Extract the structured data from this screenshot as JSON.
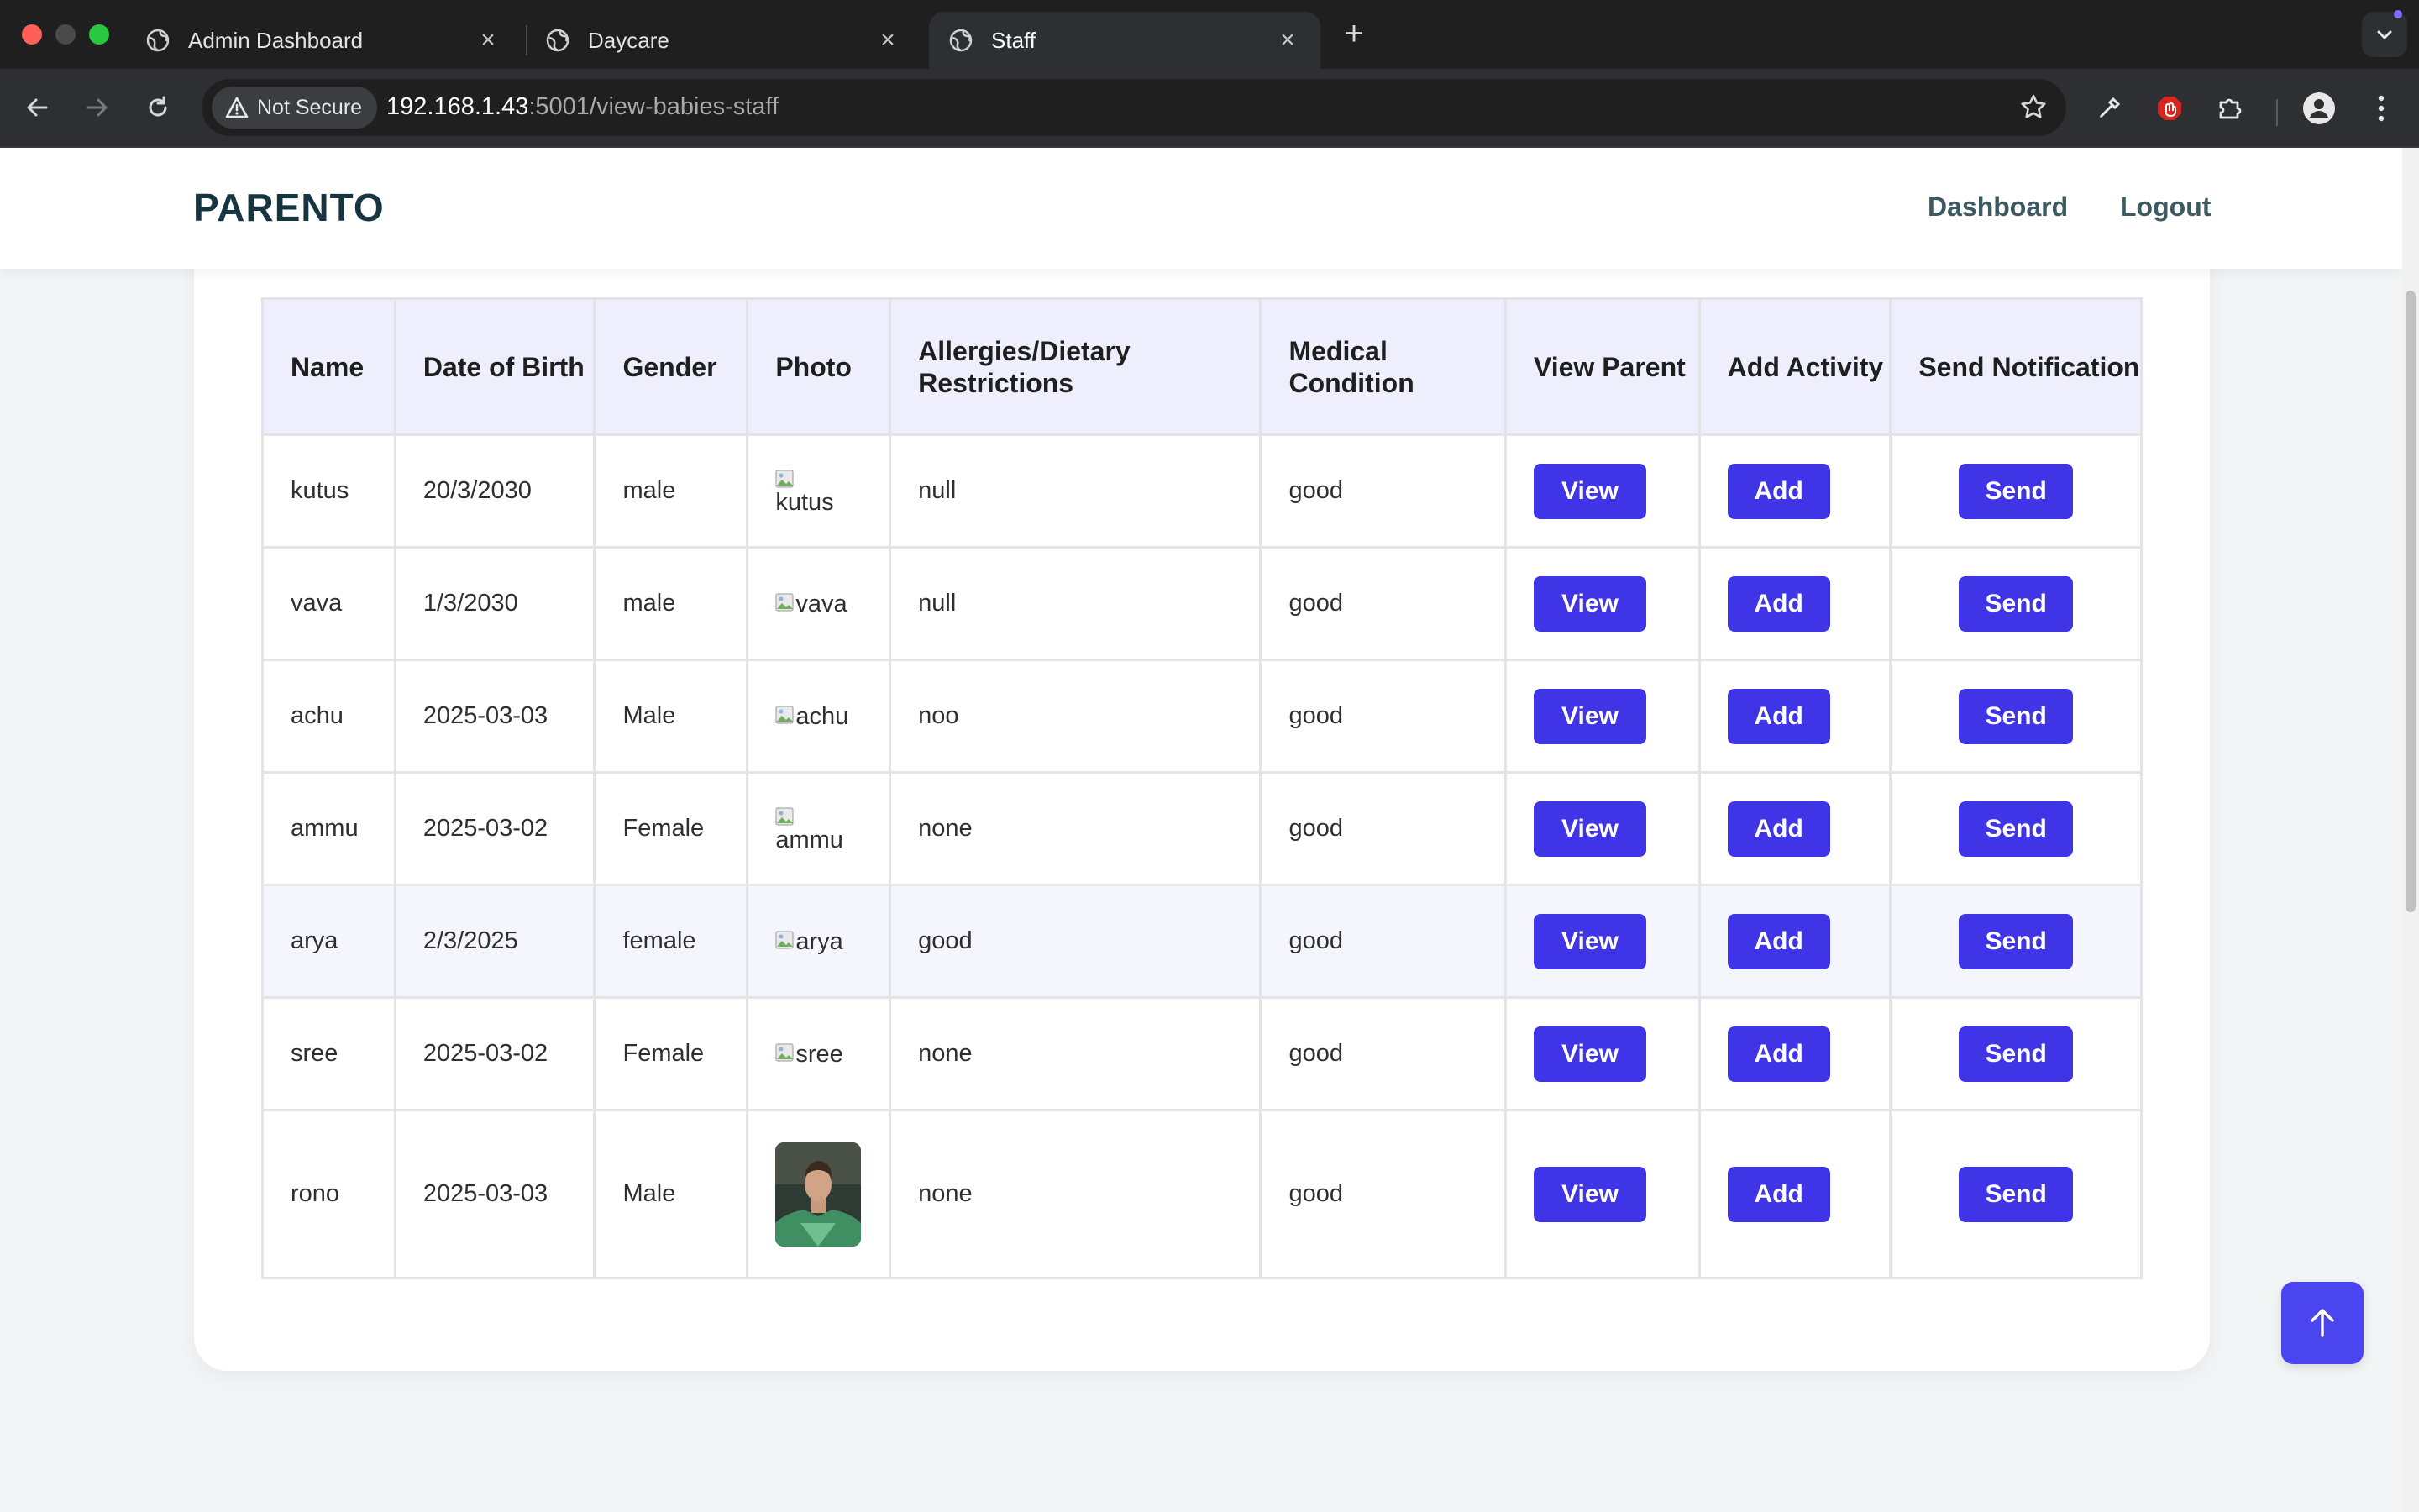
{
  "browser": {
    "tabs": [
      {
        "title": "Admin Dashboard",
        "active": false
      },
      {
        "title": "Daycare",
        "active": false
      },
      {
        "title": "Staff",
        "active": true
      }
    ],
    "address": {
      "security_label": "Not Secure",
      "host": "192.168.1.43",
      "path": ":5001/view-babies-staff"
    }
  },
  "header": {
    "logo": "PARENTO",
    "nav": {
      "dashboard": "Dashboard",
      "logout": "Logout"
    }
  },
  "table": {
    "columns": [
      "Name",
      "Date of Birth",
      "Gender",
      "Photo",
      "Allergies/Dietary Restrictions",
      "Medical Condition",
      "View Parent",
      "Add Activity",
      "Send Notification"
    ],
    "rows": [
      {
        "name": "kutus",
        "dob": "20/3/2030",
        "gender": "male",
        "photo_alt": "kutus",
        "allergies": "null",
        "medical": "good",
        "view": "View",
        "add": "Add",
        "send": "Send"
      },
      {
        "name": "vava",
        "dob": "1/3/2030",
        "gender": "male",
        "photo_alt": "vava",
        "allergies": "null",
        "medical": "good",
        "view": "View",
        "add": "Add",
        "send": "Send"
      },
      {
        "name": "achu",
        "dob": "2025-03-03",
        "gender": "Male",
        "photo_alt": "achu",
        "allergies": "noo",
        "medical": "good",
        "view": "View",
        "add": "Add",
        "send": "Send"
      },
      {
        "name": "ammu",
        "dob": "2025-03-02",
        "gender": "Female",
        "photo_alt": "ammu",
        "allergies": "none",
        "medical": "good",
        "view": "View",
        "add": "Add",
        "send": "Send"
      },
      {
        "name": "arya",
        "dob": "2/3/2025",
        "gender": "female",
        "photo_alt": "arya",
        "allergies": "good",
        "medical": "good",
        "view": "View",
        "add": "Add",
        "send": "Send"
      },
      {
        "name": "sree",
        "dob": "2025-03-02",
        "gender": "Female",
        "photo_alt": "sree",
        "allergies": "none",
        "medical": "good",
        "view": "View",
        "add": "Add",
        "send": "Send"
      },
      {
        "name": "rono",
        "dob": "2025-03-03",
        "gender": "Male",
        "photo_alt": "rono",
        "allergies": "none",
        "medical": "good",
        "view": "View",
        "add": "Add",
        "send": "Send"
      }
    ]
  },
  "colors": {
    "accent": "#3f35e6",
    "logo": "#163540",
    "header_row": "#eeeefc"
  },
  "icons": [
    "globe-icon",
    "close-icon",
    "plus-icon",
    "chevron-down-icon",
    "back-arrow-icon",
    "forward-arrow-icon",
    "reload-icon",
    "warning-icon",
    "star-icon",
    "eyedropper-icon",
    "adblock-icon",
    "puzzle-icon",
    "profile-icon",
    "kebab-menu-icon",
    "arrow-up-icon",
    "broken-image-icon"
  ]
}
